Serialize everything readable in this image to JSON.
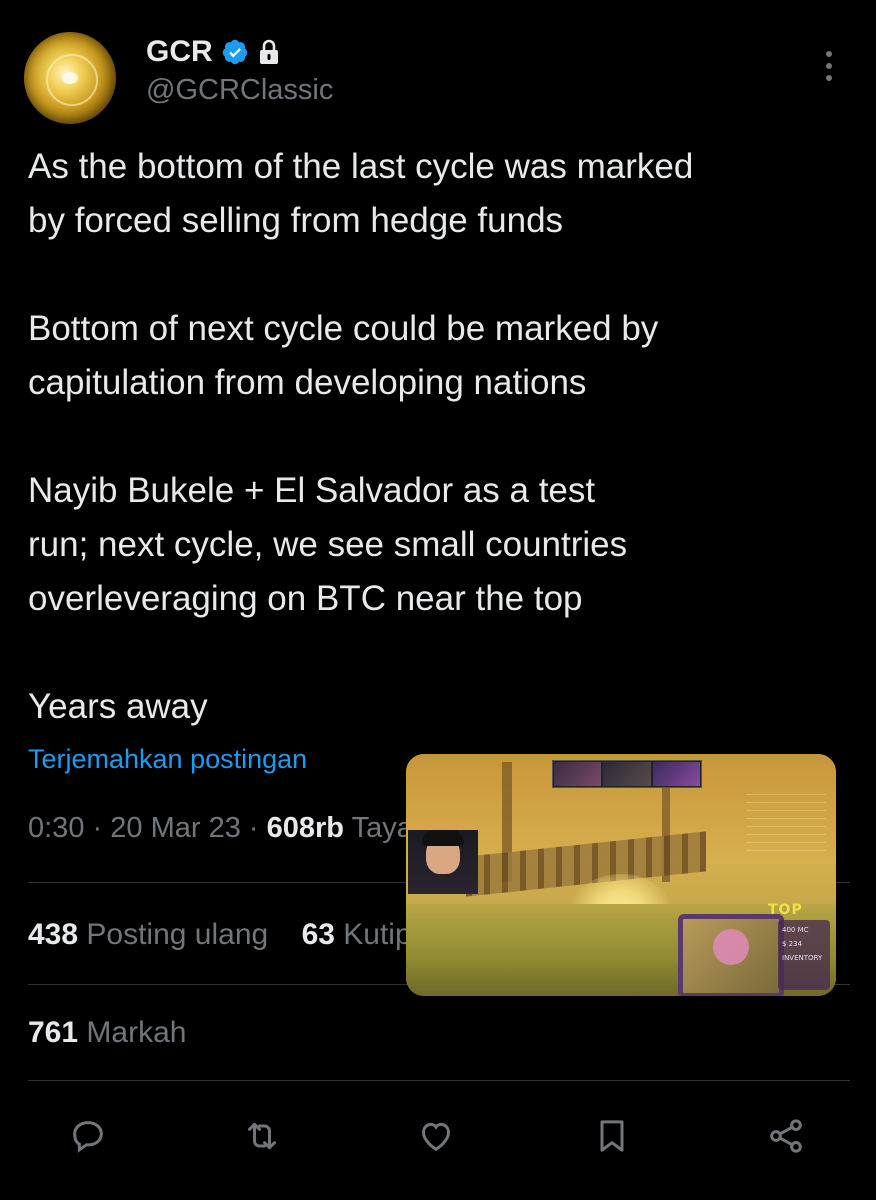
{
  "author": {
    "name": "GCR",
    "handle": "@GCRClassic",
    "verified": true,
    "protected": true,
    "avatar_icon": "gold-coin-avatar"
  },
  "tweet": {
    "paragraphs": [
      [
        "As the bottom of the last cycle was marked",
        "by forced selling from hedge funds"
      ],
      [
        "Bottom of next cycle could be marked by",
        "capitulation from developing nations"
      ],
      [
        "Nayib Bukele + El Salvador as a test",
        "run; next cycle, we see small countries",
        "overleveraging on BTC near the top"
      ],
      [
        "Years away"
      ]
    ]
  },
  "translate_link": "Terjemahkan postingan",
  "meta": {
    "time": "0:30",
    "separator": "·",
    "date": "20 Mar 23",
    "views_count": "608rb",
    "views_label": "Tayangan"
  },
  "stats": {
    "reposts_count": "438",
    "reposts_label": "Posting ulang",
    "quotes_count": "63",
    "quotes_label": "Kutipan",
    "bookmarks_count": "761",
    "bookmarks_label": "Markah"
  },
  "actions": [
    {
      "name": "reply-icon"
    },
    {
      "name": "repost-icon"
    },
    {
      "name": "like-icon"
    },
    {
      "name": "bookmark-icon"
    },
    {
      "name": "share-icon"
    }
  ],
  "overlay": {
    "hud_top_label": "TOP",
    "inventory_lines": [
      "400 MC",
      "$ 234",
      "INVENTORY"
    ]
  },
  "colors": {
    "background": "#000000",
    "text_primary": "#e7e9ea",
    "text_secondary": "#71767b",
    "link": "#1d9bf0",
    "verified_badge": "#1d9bf0",
    "divider": "#2f3336"
  }
}
